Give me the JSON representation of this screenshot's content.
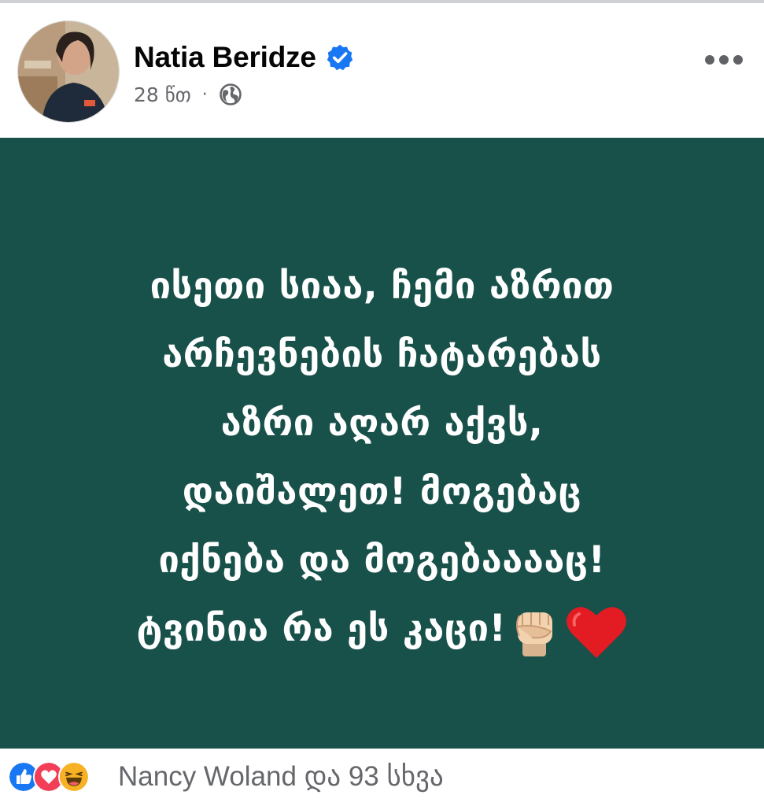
{
  "author": {
    "name": "Natia Beridze",
    "verified": true,
    "time": "28 წთ",
    "separator": "·",
    "audience_icon": "globe-icon"
  },
  "menu": {
    "icon": "more-horizontal-icon"
  },
  "post": {
    "background_color": "#18504a",
    "text_color": "#ffffff",
    "lines": [
      "ისეთი სიაა, ჩემი აზრით",
      "არჩევნების ჩატარებას",
      "აზრი აღარ  აქვს,",
      "დაიშალეთ! მოგებაც",
      "იქნება და მოგებააააც!",
      "ტვინია რა ეს კაცი!"
    ],
    "trailing_emojis": [
      "raised-fist-icon",
      "red-heart-icon"
    ]
  },
  "reactions": {
    "icons": [
      "like-icon",
      "love-icon",
      "haha-icon"
    ],
    "summary": "Nancy Woland და 93 სხვა"
  },
  "colors": {
    "verified_badge": "#1877f2",
    "like": "#1877f2",
    "love": "#f33e58",
    "haha": "#f7b125",
    "meta": "#65676b"
  }
}
